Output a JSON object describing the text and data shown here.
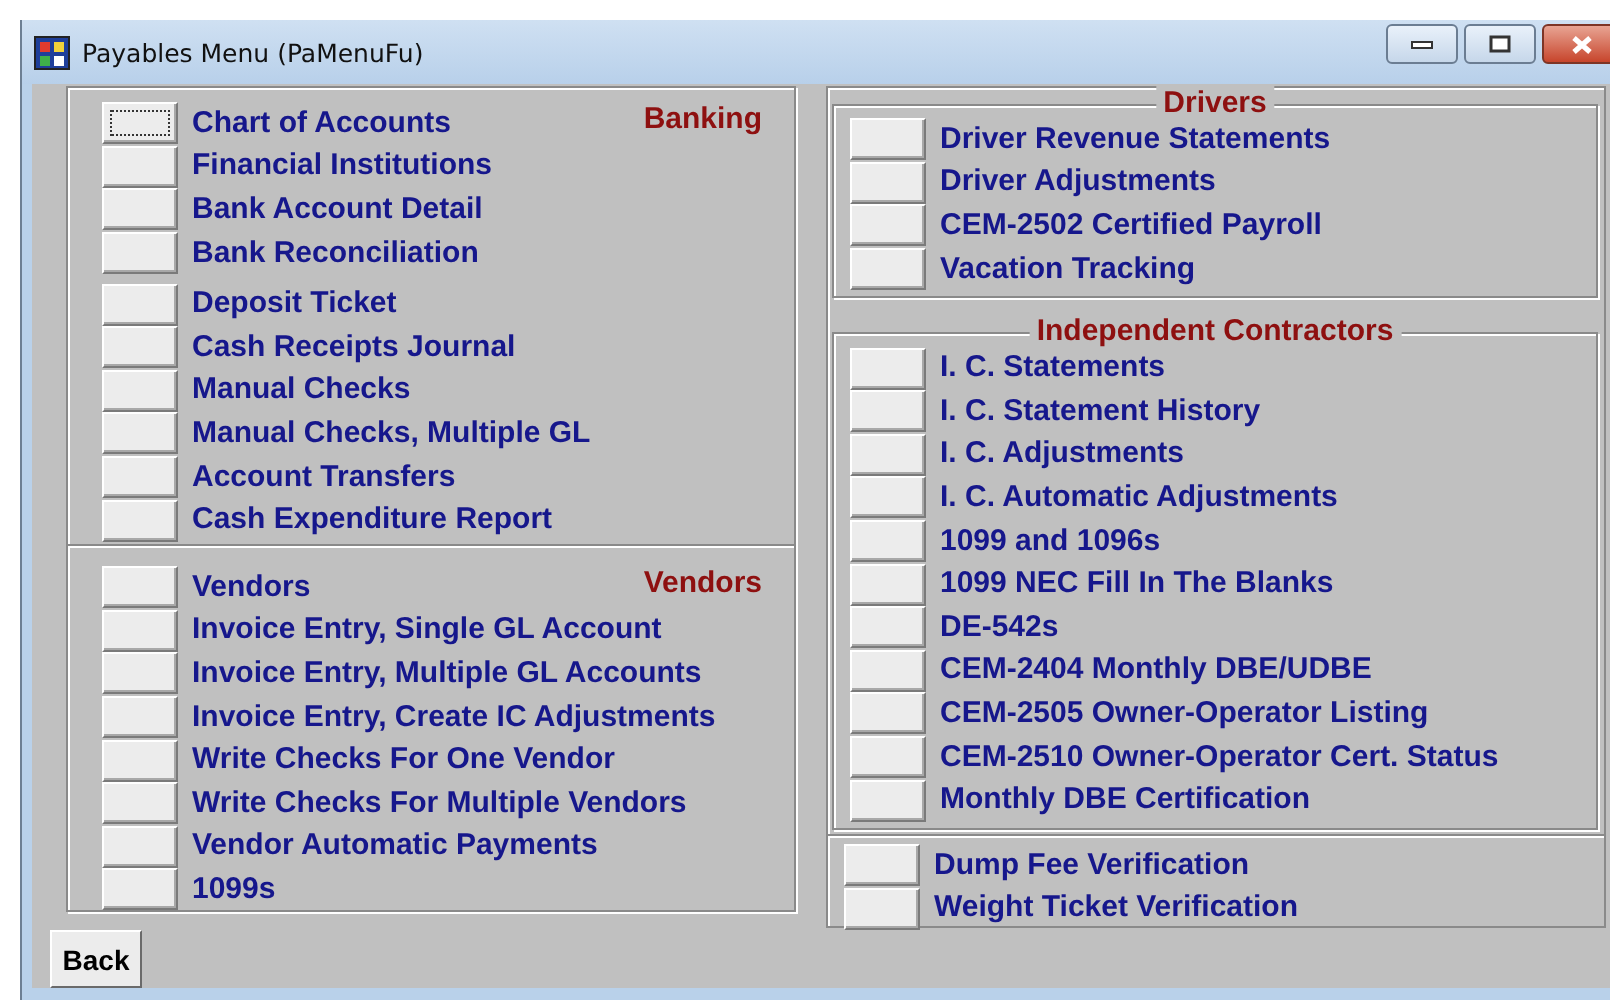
{
  "window": {
    "title": "Payables Menu (PaMenuFu)"
  },
  "left_panel": {
    "sections": [
      {
        "title": "Banking",
        "kind": "corner",
        "groups": [
          [
            {
              "label": "Chart of Accounts",
              "focused": true
            },
            {
              "label": "Financial Institutions",
              "focused": false
            },
            {
              "label": "Bank Account Detail",
              "focused": false
            },
            {
              "label": "Bank Reconciliation",
              "focused": false
            }
          ],
          [
            {
              "label": "Deposit Ticket",
              "focused": false
            },
            {
              "label": "Cash Receipts Journal",
              "focused": false
            },
            {
              "label": "Manual Checks",
              "focused": false
            },
            {
              "label": "Manual Checks, Multiple GL",
              "focused": false
            },
            {
              "label": "Account Transfers",
              "focused": false
            },
            {
              "label": "Cash Expenditure Report",
              "focused": false
            }
          ]
        ]
      },
      {
        "title": "Vendors",
        "kind": "corner",
        "groups": [
          [
            {
              "label": "Vendors",
              "focused": false
            },
            {
              "label": "Invoice Entry, Single GL Account",
              "focused": false
            },
            {
              "label": "Invoice Entry, Multiple GL Accounts",
              "focused": false
            },
            {
              "label": "Invoice Entry, Create IC Adjustments",
              "focused": false
            },
            {
              "label": "Write Checks For One Vendor",
              "focused": false
            },
            {
              "label": "Write Checks For Multiple Vendors",
              "focused": false
            },
            {
              "label": "Vendor Automatic Payments",
              "focused": false
            },
            {
              "label": "1099s",
              "focused": false
            }
          ]
        ]
      }
    ]
  },
  "right_panel": {
    "sections": [
      {
        "title": "Drivers",
        "kind": "legend",
        "groups": [
          [
            {
              "label": "Driver Revenue Statements",
              "focused": false
            },
            {
              "label": "Driver Adjustments",
              "focused": false
            },
            {
              "label": "CEM-2502 Certified Payroll",
              "focused": false
            },
            {
              "label": "Vacation Tracking",
              "focused": false
            }
          ]
        ]
      },
      {
        "title": "Independent Contractors",
        "kind": "legend",
        "groups": [
          [
            {
              "label": "I. C. Statements",
              "focused": false
            },
            {
              "label": "I. C. Statement History",
              "focused": false
            },
            {
              "label": "I. C. Adjustments",
              "focused": false
            },
            {
              "label": "I. C. Automatic Adjustments",
              "focused": false
            },
            {
              "label": "1099 and 1096s",
              "focused": false
            },
            {
              "label": "1099 NEC Fill In The Blanks",
              "focused": false
            },
            {
              "label": "DE-542s",
              "focused": false
            },
            {
              "label": "CEM-2404 Monthly DBE/UDBE",
              "focused": false
            },
            {
              "label": "CEM-2505 Owner-Operator Listing",
              "focused": false
            },
            {
              "label": "CEM-2510 Owner-Operator Cert. Status",
              "focused": false
            },
            {
              "label": "Monthly DBE Certification",
              "focused": false
            }
          ]
        ]
      },
      {
        "kind": "plain",
        "groups": [
          [
            {
              "label": "Dump Fee Verification",
              "focused": false
            },
            {
              "label": "Weight Ticket Verification",
              "focused": false
            }
          ]
        ]
      }
    ]
  },
  "back_button": {
    "label": "Back"
  }
}
